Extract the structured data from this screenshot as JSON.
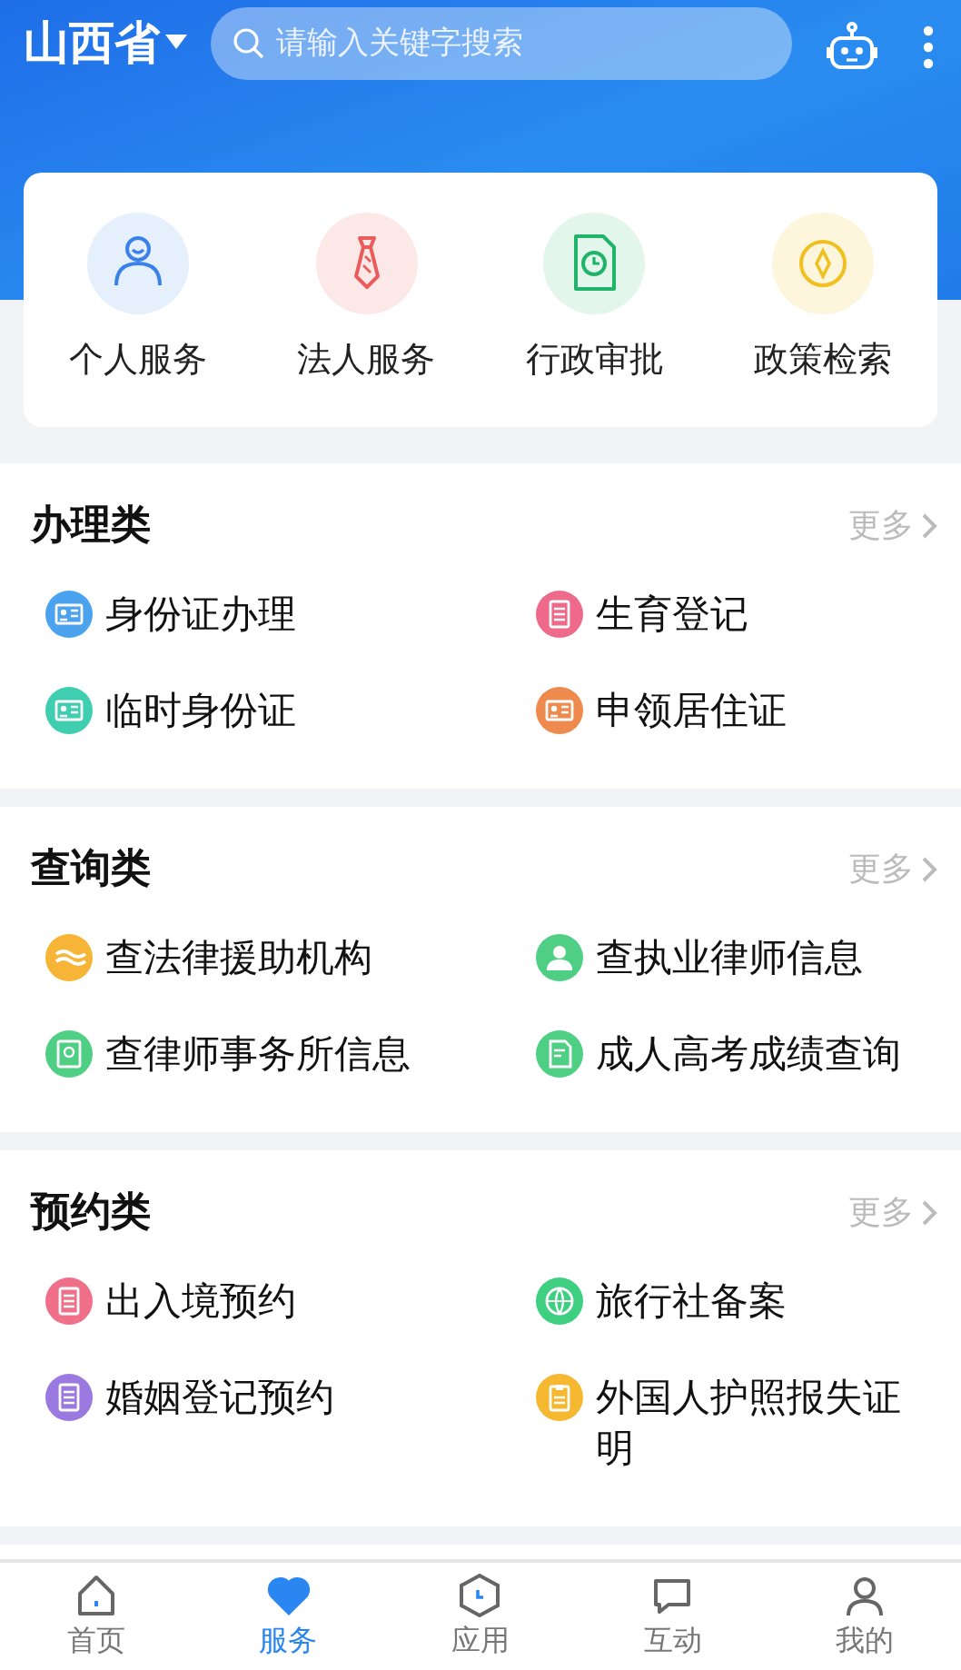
{
  "header": {
    "region": "山西省",
    "search": {
      "placeholder": "请输入关键字搜索"
    }
  },
  "quick_services": [
    {
      "label": "个人服务"
    },
    {
      "label": "法人服务"
    },
    {
      "label": "行政审批"
    },
    {
      "label": "政策检索"
    }
  ],
  "sections": [
    {
      "title": "办理类",
      "more": "更多",
      "items": [
        {
          "label": "身份证办理",
          "color": "#4ba3f0"
        },
        {
          "label": "生育登记",
          "color": "#ef6a8a"
        },
        {
          "label": "临时身份证",
          "color": "#3fcfb0"
        },
        {
          "label": "申领居住证",
          "color": "#ef8a4f"
        }
      ]
    },
    {
      "title": "查询类",
      "more": "更多",
      "items": [
        {
          "label": "查法律援助机构",
          "color": "#f6b536"
        },
        {
          "label": "查执业律师信息",
          "color": "#4fcf84"
        },
        {
          "label": "查律师事务所信息",
          "color": "#4fcf84"
        },
        {
          "label": "成人高考成绩查询",
          "color": "#4fcf84"
        }
      ]
    },
    {
      "title": "预约类",
      "more": "更多",
      "items": [
        {
          "label": "出入境预约",
          "color": "#f0708a"
        },
        {
          "label": "旅行社备案",
          "color": "#3fcf80"
        },
        {
          "label": "婚姻登记预约",
          "color": "#9a7ae0"
        },
        {
          "label": "外国人护照报失证明",
          "color": "#f6b830"
        }
      ]
    }
  ],
  "bottom_nav": [
    {
      "label": "首页",
      "selected": false
    },
    {
      "label": "服务",
      "selected": true
    },
    {
      "label": "应用",
      "selected": false
    },
    {
      "label": "互动",
      "selected": false
    },
    {
      "label": "我的",
      "selected": false
    }
  ]
}
